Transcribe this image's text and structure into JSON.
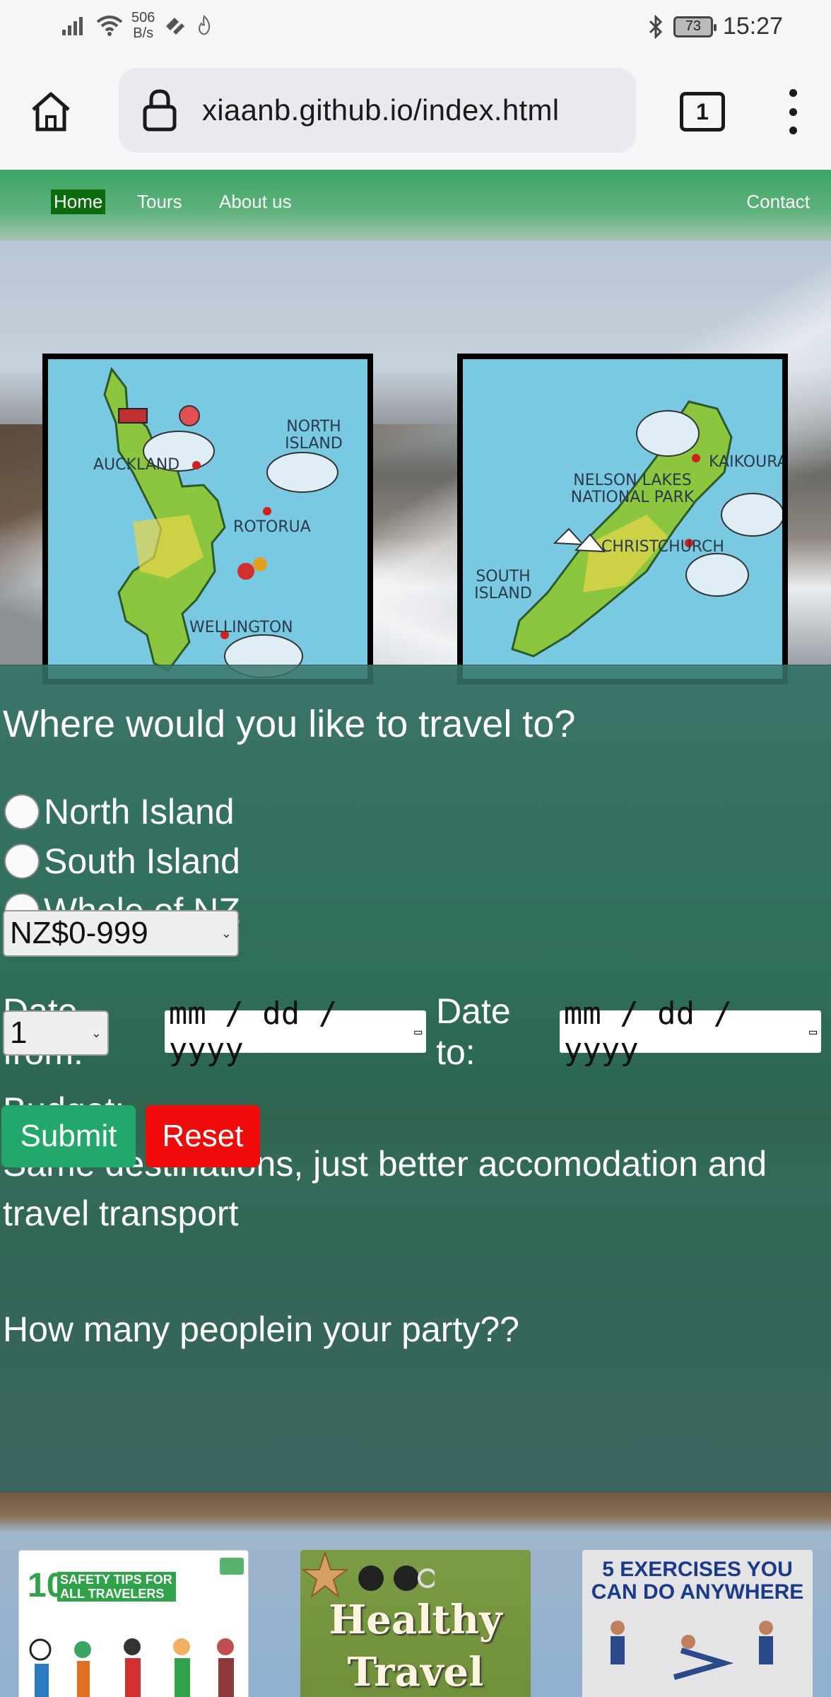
{
  "status_bar": {
    "net_speed_value": "506",
    "net_speed_unit": "B/s",
    "battery": "73",
    "time": "15:27"
  },
  "browser": {
    "url": "xiaanb.github.io/index.html",
    "tab_count": "1"
  },
  "nav": {
    "items": [
      {
        "label": "Home",
        "active": true
      },
      {
        "label": "Tours"
      },
      {
        "label": "About us"
      },
      {
        "label": "Contact"
      }
    ]
  },
  "maps": {
    "north": {
      "title": "NORTH ISLAND",
      "places": [
        "AUCKLAND",
        "ROTORUA",
        "WELLINGTON"
      ]
    },
    "south": {
      "title": "SOUTH ISLAND",
      "places": [
        "NELSON LAKES NATIONAL PARK",
        "KAIKOURA",
        "CHRISTCHURCH"
      ]
    }
  },
  "form": {
    "title": "Where would you like to travel to?",
    "destinations": [
      "North Island",
      "South Island",
      "Whole of NZ"
    ],
    "date_from_label": "Date from:",
    "date_to_label": "Date to:",
    "date_placeholder": "mm / dd / yyyy",
    "budget_label": "Budget:",
    "budget_note": "Same destinations, just better accomodation and travel transport",
    "budget_selected": "NZ$0-999",
    "party_label": "How many peoplein your party??",
    "party_selected": "1",
    "submit_label": "Submit",
    "reset_label": "Reset"
  },
  "cards": {
    "safety": {
      "number": "10",
      "title": "SAFETY TIPS FOR ALL TRAVELERS"
    },
    "healthy": {
      "line1": "Healthy",
      "line2": "Travel"
    },
    "exercises": {
      "title": "5 EXERCISES YOU CAN DO ANYWHERE"
    }
  },
  "colors": {
    "nav_active_bg": "#0c6b0c",
    "submit_bg": "#21a86a",
    "reset_bg": "#f00a0a",
    "map_sea": "#79c9e2",
    "map_land": "#8cc63f"
  }
}
